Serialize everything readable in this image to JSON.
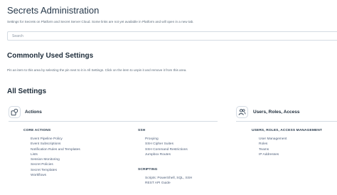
{
  "header": {
    "title": "Secrets Administration",
    "subtitle": "Settings for Secrets on Platform and Secret Server Cloud. Some links are not yet available in Platform and will open in a new tab."
  },
  "search": {
    "placeholder": "Search",
    "value": ""
  },
  "common": {
    "heading": "Commonly Used Settings",
    "hint": "Pin an item to this area by selecting the pin next to it in All Settings. Click on the item to unpin it and remove it from this area."
  },
  "all": {
    "heading": "All Settings",
    "categories": [
      {
        "title": "Actions",
        "icon": "actions-icon",
        "groups": [
          {
            "header": "CORE ACTIONS",
            "items": [
              "Event Pipeline Policy",
              "Event Subscriptions",
              "Notification Rules and Templates",
              "Lists",
              "Session Monitoring",
              "Secret Policies",
              "Secret Templates",
              "Workflows"
            ]
          },
          {
            "header": "SSH",
            "items": [
              "Proxying",
              "SSH Cipher Suites",
              "SSH Command Restrictions",
              "Jumpbox Routes"
            ]
          },
          {
            "header": "SCRIPTING",
            "items": [
              "Scripts: PowerShell, SQL, SSH",
              "REST API Guide"
            ]
          }
        ]
      },
      {
        "title": "Users, Roles, Access",
        "icon": "users-icon",
        "groups": [
          {
            "header": "USERS, ROLES, ACCESS MANAGEMENT",
            "items": [
              "User Management",
              "Roles",
              "Teams",
              "IP Addresses"
            ]
          }
        ]
      }
    ]
  }
}
